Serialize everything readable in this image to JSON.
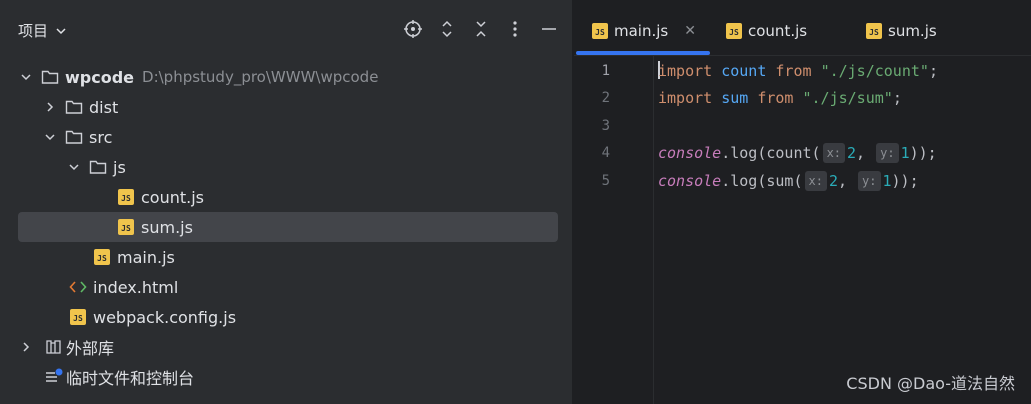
{
  "project_panel": {
    "title": "项目",
    "tree": [
      {
        "label": "wpcode",
        "path": "D:\\phpstudy_pro\\WWW\\wpcode",
        "type": "folder",
        "expanded": true,
        "depth": 0
      },
      {
        "label": "dist",
        "type": "folder",
        "expanded": false,
        "depth": 1
      },
      {
        "label": "src",
        "type": "folder",
        "expanded": true,
        "depth": 1
      },
      {
        "label": "js",
        "type": "folder",
        "expanded": true,
        "depth": 2
      },
      {
        "label": "count.js",
        "type": "js",
        "depth": 3
      },
      {
        "label": "sum.js",
        "type": "js",
        "depth": 3,
        "selected": true
      },
      {
        "label": "main.js",
        "type": "js",
        "depth": 2
      },
      {
        "label": "index.html",
        "type": "html",
        "depth": 1
      },
      {
        "label": "webpack.config.js",
        "type": "js",
        "depth": 1
      },
      {
        "label": "外部库",
        "type": "library",
        "depth": 0
      },
      {
        "label": "临时文件和控制台",
        "type": "scratches",
        "depth": 0
      }
    ]
  },
  "editor": {
    "tabs": [
      {
        "label": "main.js",
        "active": true,
        "badge": "JS"
      },
      {
        "label": "count.js",
        "active": false,
        "badge": "JS"
      },
      {
        "label": "sum.js",
        "active": false,
        "badge": "JS"
      }
    ],
    "line_numbers": [
      "1",
      "2",
      "3",
      "4",
      "5"
    ],
    "code": {
      "l1": {
        "kw1": "import",
        "id": "count",
        "kw2": "from",
        "str": "\"./js/count\"",
        "end": ";"
      },
      "l2": {
        "kw1": "import",
        "id": "sum",
        "kw2": "from",
        "str": "\"./js/sum\"",
        "end": ";"
      },
      "l4": {
        "obj": "console",
        "dot": ".log(",
        "fn": "count(",
        "hint_x": "x:",
        "a": "2",
        "comma": ", ",
        "hint_y": "y:",
        "b": "1",
        "end": "));"
      },
      "l5": {
        "obj": "console",
        "dot": ".log(",
        "fn": "sum(",
        "hint_x": "x:",
        "a": "2",
        "comma": ", ",
        "hint_y": "y:",
        "b": "1",
        "end": "));"
      }
    }
  },
  "watermark": "CSDN @Dao-道法自然",
  "colors": {
    "accent": "#3574f0",
    "js_badge": "#f0c44c",
    "panel_bg": "#2b2d30",
    "editor_bg": "#1e1f22",
    "selection": "#43454a"
  }
}
